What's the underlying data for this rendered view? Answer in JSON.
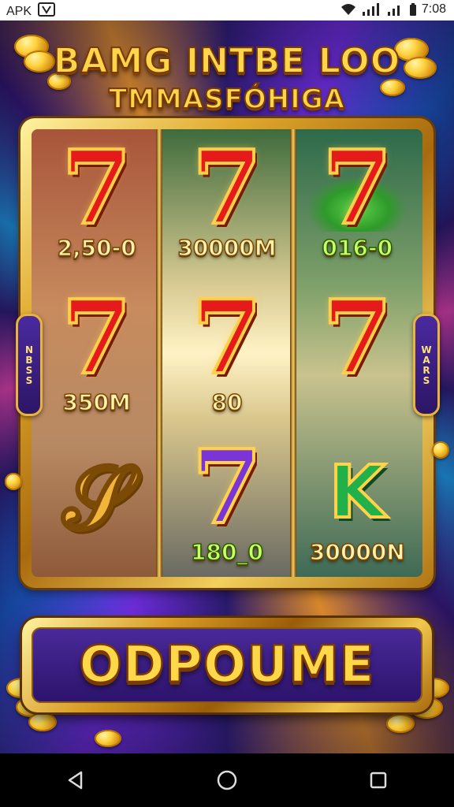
{
  "status_bar": {
    "carrier_label": "APK",
    "time": "7:08"
  },
  "game": {
    "title_line_1": "BAMG INTBE LOO",
    "title_line_2": "TMMASFÓHIGA",
    "reels": [
      {
        "cells": [
          {
            "symbol": "7",
            "style": "red",
            "prize": "2,50-0"
          },
          {
            "symbol": "7",
            "style": "red",
            "prize": "350M"
          },
          {
            "symbol": "dragon",
            "style": "gold",
            "prize": ""
          }
        ]
      },
      {
        "cells": [
          {
            "symbol": "7",
            "style": "red",
            "prize": "30000M"
          },
          {
            "symbol": "7",
            "style": "red",
            "prize": "80"
          },
          {
            "symbol": "7",
            "style": "rainbow",
            "prize": "180_0"
          }
        ]
      },
      {
        "cells": [
          {
            "symbol": "7",
            "style": "red",
            "prize": "016-0"
          },
          {
            "symbol": "7",
            "style": "red",
            "prize": ""
          },
          {
            "symbol": "K",
            "style": "green",
            "prize": "30000N"
          }
        ]
      }
    ],
    "side_left_label": "NBSS",
    "side_right_label": "WARS",
    "spin_button_label": "ODPOUME"
  },
  "colors": {
    "gold": "#ffd54a",
    "frame_gold": "#e0a92e",
    "seven_red": "#e51b1b",
    "background_purple": "#2a1a6b"
  },
  "nav_icons": [
    "back-triangle-icon",
    "home-circle-icon",
    "recents-square-icon"
  ]
}
